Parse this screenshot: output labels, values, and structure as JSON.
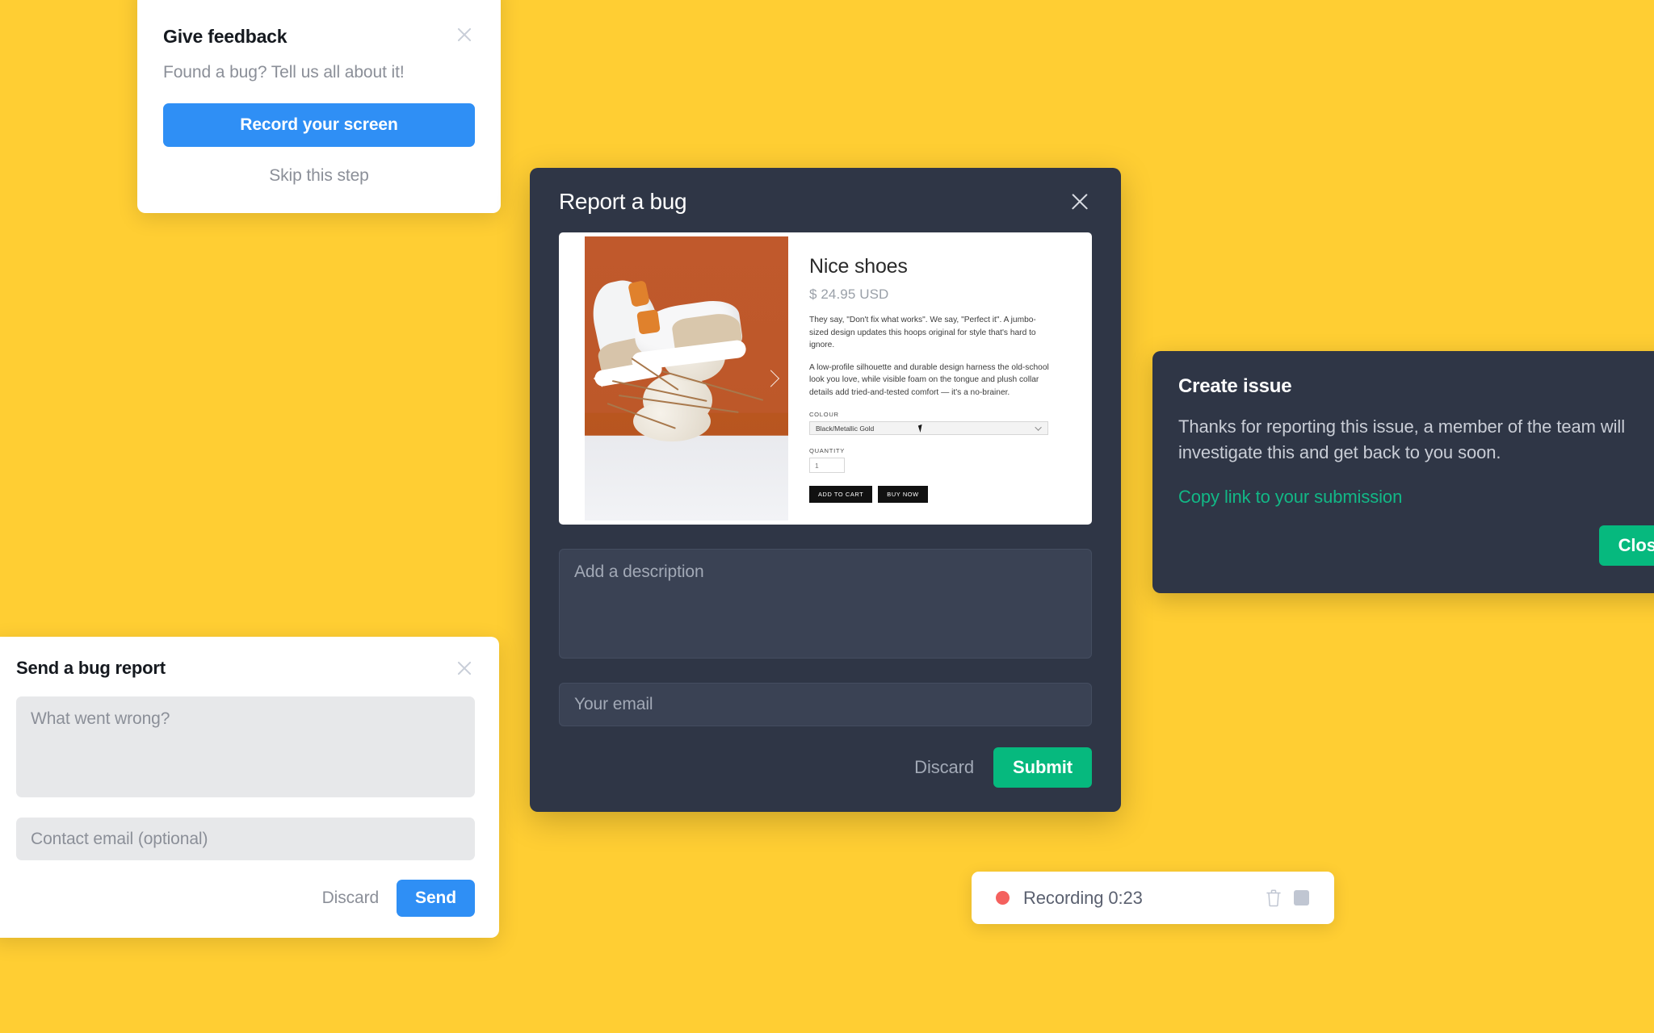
{
  "theme": {
    "background": "#FFCE33",
    "dark_panel": "#2F3646",
    "blue_accent": "#2F8FF5",
    "green_accent": "#06B97E",
    "link_green": "#12B886",
    "record_red": "#F4615E"
  },
  "give_feedback": {
    "title": "Give feedback",
    "subtitle": "Found a bug? Tell us all about it!",
    "primary_button": "Record your screen",
    "skip_link": "Skip this step"
  },
  "send_bug_report": {
    "title": "Send a bug report",
    "message_placeholder": "What went wrong?",
    "message_value": "",
    "email_placeholder": "Contact email (optional)",
    "email_value": "",
    "discard_label": "Discard",
    "send_label": "Send"
  },
  "report_bug": {
    "title": "Report a bug",
    "description_placeholder": "Add a description",
    "description_value": "",
    "email_placeholder": "Your email",
    "email_value": "",
    "discard_label": "Discard",
    "submit_label": "Submit",
    "screenshot": {
      "product_name": "Nice shoes",
      "price": "$ 24.95 USD",
      "paragraph_1": "They say, \"Don't fix what works\". We say, \"Perfect it\". A jumbo-sized design updates this hoops original for style that's hard to ignore.",
      "paragraph_2": "A low-profile silhouette and durable design harness the old-school look you love, while visible foam on the tongue and plush collar details add tried-and-tested comfort — it's a no-brainer.",
      "colour_label": "COLOUR",
      "colour_value": "Black/Metallic Gold",
      "quantity_label": "QUANTITY",
      "quantity_value": "1",
      "add_to_cart_label": "ADD TO CART",
      "buy_now_label": "BUY NOW"
    }
  },
  "create_issue": {
    "title": "Create issue",
    "body": "Thanks for reporting this issue, a member of the team will investigate this and get back to you soon.",
    "copy_link_label": "Copy link to your submission",
    "close_label": "Close"
  },
  "recording": {
    "status_label": "Recording 0:23"
  }
}
